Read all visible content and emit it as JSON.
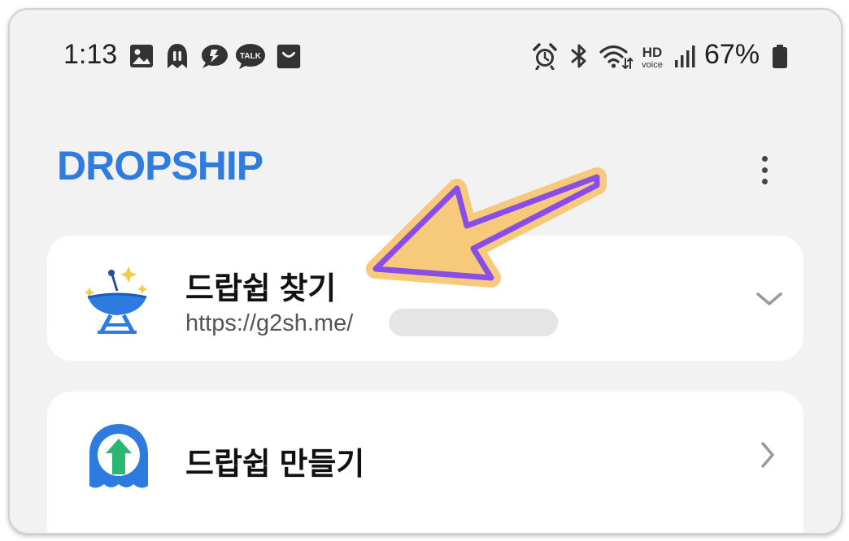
{
  "status_bar": {
    "time": "1:13",
    "left_icons": [
      "gallery-icon",
      "app-icon",
      "chat-bubble-icon",
      "kakaotalk-icon",
      "shopping-bag-icon"
    ],
    "talk_label": "TALK",
    "right_icons": [
      "alarm-icon",
      "bluetooth-icon",
      "wifi-icon",
      "hd-voice-icon",
      "signal-icon",
      "battery-icon"
    ],
    "hd_label": "HD",
    "voice_label": "voice",
    "battery_percent": "67%"
  },
  "header": {
    "title": "DROPSHIP",
    "title_color": "#2f7cde"
  },
  "cards": [
    {
      "title": "드랍쉽 찾기",
      "url": "https://g2sh.me/",
      "icon": "satellite-dish-icon",
      "chevron": "chevron-down-icon"
    },
    {
      "title": "드랍쉽 만들기",
      "icon": "upload-ghost-icon",
      "chevron": "chevron-right-icon"
    }
  ],
  "annotation": {
    "type": "arrow",
    "fill_color": "#f7c97a",
    "stroke_color": "#8a4ee8"
  }
}
